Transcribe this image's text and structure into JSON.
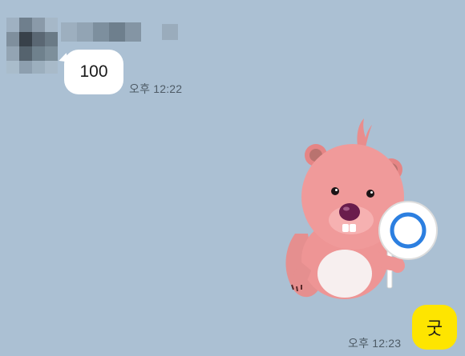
{
  "incoming_message": {
    "text": "100",
    "time": "오후 12:22"
  },
  "outgoing_sticker": {
    "icon": "beaver-holding-o-sign-sticker"
  },
  "outgoing_message": {
    "text": "굿",
    "time": "오후 12:23"
  },
  "colors": {
    "background": "#abc0d3",
    "incoming_bubble": "#ffffff",
    "outgoing_bubble": "#fee500"
  }
}
